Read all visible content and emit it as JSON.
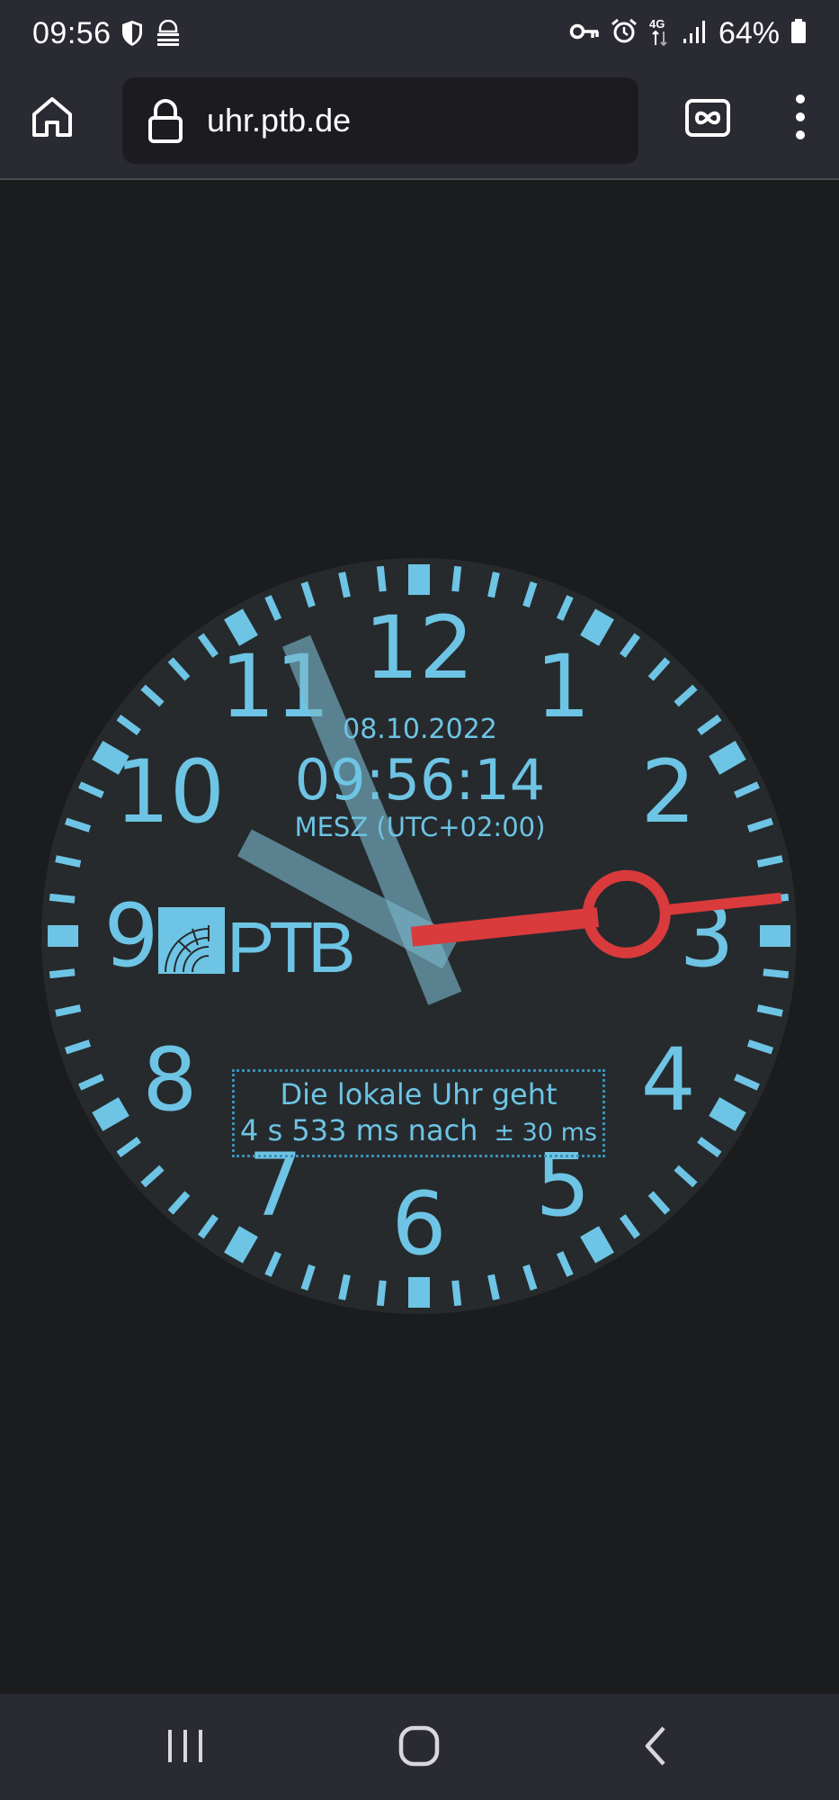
{
  "status_bar": {
    "time": "09:56",
    "left_icons": [
      "shield-icon",
      "sim-toolkit-icon"
    ],
    "right_icons": [
      "vpn-key-icon",
      "alarm-icon",
      "4g-data-icon",
      "signal-icon"
    ],
    "battery": "64%"
  },
  "browser": {
    "url": "uhr.ptb.de",
    "icons": [
      "home-icon",
      "lock-icon",
      "tabs-icon",
      "menu-icon"
    ]
  },
  "clock": {
    "date": "08.10.2022",
    "time": "09:56:14",
    "timezone": "MESZ (UTC+02:00)",
    "numerals": [
      "12",
      "1",
      "2",
      "3",
      "4",
      "5",
      "6",
      "7",
      "8",
      "9",
      "10",
      "11"
    ],
    "logo_text": "PTB",
    "hours": 9,
    "minutes": 56,
    "seconds": 14,
    "colors": {
      "face": "#262a2d",
      "accent": "#6ec4e4",
      "hand": "#79b6cc",
      "second_hand": "#d93a3c"
    },
    "offset": {
      "line1": "Die lokale Uhr geht",
      "line2": "4 s 533 ms nach",
      "accuracy": "± 30 ms"
    }
  },
  "nav_bar": {
    "icons": [
      "recent-apps-icon",
      "home-circle-icon",
      "back-icon"
    ]
  }
}
